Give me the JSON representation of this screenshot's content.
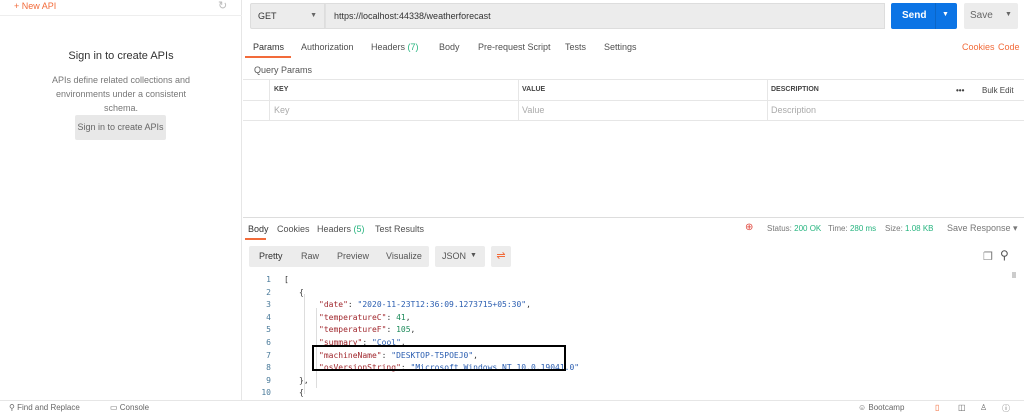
{
  "sidebar": {
    "new_api": "+ New API",
    "sign_title": "Sign in to create APIs",
    "sign_desc": "APIs define related collections and environments under a consistent schema.",
    "sign_button": "Sign in to create APIs"
  },
  "request": {
    "method": "GET",
    "url": "https://localhost:44338/weatherforecast",
    "send": "Send",
    "save": "Save"
  },
  "tabs": {
    "params": "Params",
    "authorization": "Authorization",
    "headers": "Headers",
    "headers_count": "(7)",
    "body": "Body",
    "prerequest": "Pre-request Script",
    "tests": "Tests",
    "settings": "Settings",
    "cookies": "Cookies",
    "code": "Code"
  },
  "params": {
    "title": "Query Params",
    "columns": [
      "KEY",
      "VALUE",
      "DESCRIPTION"
    ],
    "placeholders": [
      "Key",
      "Value",
      "Description"
    ],
    "more": "•••",
    "bulk_edit": "Bulk Edit"
  },
  "response": {
    "tabs": {
      "body": "Body",
      "cookies": "Cookies",
      "headers": "Headers",
      "headers_count": "(5)",
      "test_results": "Test Results"
    },
    "status_label": "Status:",
    "status": "200 OK",
    "time_label": "Time:",
    "time": "280 ms",
    "size_label": "Size:",
    "size": "1.08 KB",
    "save_response": "Save Response",
    "views": [
      "Pretty",
      "Raw",
      "Preview",
      "Visualize"
    ],
    "format": "JSON"
  },
  "code_lines": [
    {
      "n": "1",
      "parts": [
        [
          "p",
          "["
        ]
      ]
    },
    {
      "n": "2",
      "parts": [
        [
          "p",
          "{"
        ]
      ]
    },
    {
      "n": "3",
      "parts": [
        [
          "k",
          "\"date\""
        ],
        [
          "p",
          ": "
        ],
        [
          "s",
          "\"2020-11-23T12:36:09.1273715+05:30\""
        ],
        [
          "p",
          ","
        ]
      ]
    },
    {
      "n": "4",
      "parts": [
        [
          "k",
          "\"temperatureC\""
        ],
        [
          "p",
          ": "
        ],
        [
          "n",
          "41"
        ],
        [
          "p",
          ","
        ]
      ]
    },
    {
      "n": "5",
      "parts": [
        [
          "k",
          "\"temperatureF\""
        ],
        [
          "p",
          ": "
        ],
        [
          "n",
          "105"
        ],
        [
          "p",
          ","
        ]
      ]
    },
    {
      "n": "6",
      "parts": [
        [
          "k",
          "\"summary\""
        ],
        [
          "p",
          ": "
        ],
        [
          "s",
          "\"Cool\""
        ],
        [
          "p",
          ","
        ]
      ]
    },
    {
      "n": "7",
      "parts": [
        [
          "k",
          "\"machineName\""
        ],
        [
          "p",
          ": "
        ],
        [
          "s",
          "\"DESKTOP-T5POEJ0\""
        ],
        [
          "p",
          ","
        ]
      ]
    },
    {
      "n": "8",
      "parts": [
        [
          "k",
          "\"osVersionString\""
        ],
        [
          "p",
          ": "
        ],
        [
          "s",
          "\"Microsoft Windows NT 10.0.19041.0\""
        ]
      ]
    },
    {
      "n": "9",
      "parts": [
        [
          "p",
          "},"
        ]
      ]
    },
    {
      "n": "10",
      "parts": [
        [
          "p",
          "{"
        ]
      ]
    }
  ],
  "bottom": {
    "find": "Find and Replace",
    "console": "Console",
    "bootcamp": "Bootcamp"
  }
}
